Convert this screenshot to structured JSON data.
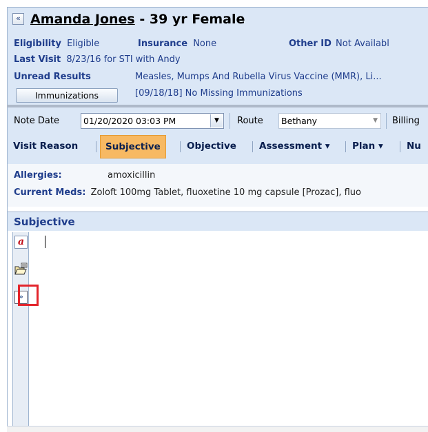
{
  "header": {
    "collapse_icon": "«",
    "patient_name": "Amanda Jones",
    "patient_suffix": " - 39 yr Female",
    "eligibility_label": "Eligibility",
    "eligibility_value": "Eligible",
    "insurance_label": "Insurance",
    "insurance_value": "None",
    "other_id_label": "Other ID",
    "other_id_value": "Not Availabl",
    "last_visit_label": "Last Visit",
    "last_visit_value": "8/23/16 for STI with Andy",
    "unread_label": "Unread Results",
    "unread_value": "Measles, Mumps And Rubella Virus Vaccine (MMR), Li...",
    "immunizations_button": "Immunizations",
    "immunizations_status": "[09/18/18] No Missing Immunizations"
  },
  "toolbar": {
    "note_date_label": "Note Date",
    "note_date_value": "01/20/2020 03:03 PM",
    "route_label": "Route",
    "route_value": "Bethany",
    "billing_label": "Billing",
    "tabs": {
      "visit_reason": "Visit Reason",
      "subjective": "Subjective",
      "objective": "Objective",
      "assessment": "Assessment ▾",
      "plan": "Plan ▾",
      "nu": "Nu"
    },
    "active_tab": "Subjective"
  },
  "info": {
    "allergies_label": "Allergies:",
    "allergies_value": "amoxicillin",
    "meds_label": "Current Meds:",
    "meds_value": "Zoloft 100mg Tablet, fluoxetine 10 mg capsule [Prozac], fluo"
  },
  "subjective": {
    "title": "Subjective",
    "icons": [
      "text-format-icon",
      "open-folder-icon",
      "expand-icon"
    ],
    "expand_glyph": "»"
  },
  "colors": {
    "header_bg": "#dbe7f6",
    "label_blue": "#1f3d8c",
    "active_tab": "#f7b963",
    "highlight": "#e3242b"
  }
}
